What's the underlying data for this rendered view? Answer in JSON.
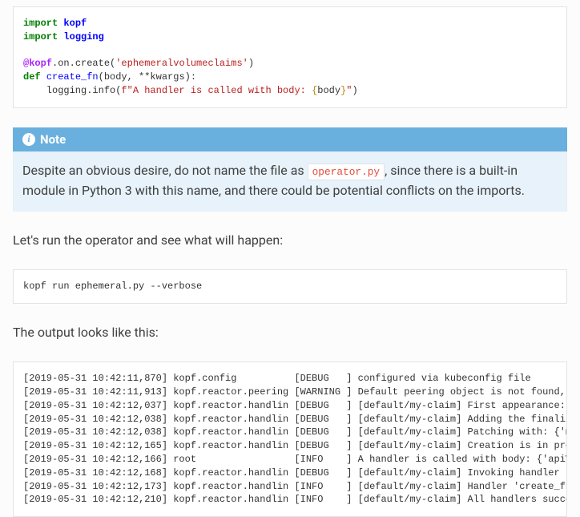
{
  "code": {
    "import_kw": "import",
    "kopf": "kopf",
    "logging": "logging",
    "at": "@kopf",
    "decorator_tail": ".on.create(",
    "resource": "'ephemeralvolumeclaims'",
    "decorator_close": ")",
    "def_kw": "def",
    "fn_name": "create_fn",
    "fn_sig": "(body, **kwargs):",
    "log_call": "    logging.info(",
    "fprefix": "f\"A handler is called with body: ",
    "interp_open": "{",
    "interp_var": "body",
    "interp_close": "}",
    "fclose": "\"",
    "call_close": ")"
  },
  "note": {
    "title": "Note",
    "body_before": "Despite an obvious desire, do not name the file as ",
    "code": "operator.py",
    "body_after": ", since there is a built-in module in Python 3 with this name, and there could be potential conflicts on the imports."
  },
  "para1": "Let's run the operator and see what will happen:",
  "shell": "kopf run ephemeral.py --verbose",
  "para2": "The output looks like this:",
  "log_lines": [
    "[2019-05-31 10:42:11,870] kopf.config          [DEBUG   ] configured via kubeconfig file",
    "[2019-05-31 10:42:11,913] kopf.reactor.peering [WARNING ] Default peering object is not found, falling b",
    "[2019-05-31 10:42:12,037] kopf.reactor.handlin [DEBUG   ] [default/my-claim] First appearance: {'apiVers",
    "[2019-05-31 10:42:12,038] kopf.reactor.handlin [DEBUG   ] [default/my-claim] Adding the finalizer, thus ",
    "[2019-05-31 10:42:12,038] kopf.reactor.handlin [DEBUG   ] [default/my-claim] Patching with: {'metadata' ",
    "[2019-05-31 10:42:12,165] kopf.reactor.handlin [DEBUG   ] [default/my-claim] Creation is in progress: {'",
    "[2019-05-31 10:42:12,166] root                 [INFO    ] A handler is called with body: {'apiVersion': ",
    "[2019-05-31 10:42:12,168] kopf.reactor.handlin [DEBUG   ] [default/my-claim] Invoking handler 'create_fn",
    "[2019-05-31 10:42:12,173] kopf.reactor.handlin [INFO    ] [default/my-claim] Handler 'create_fn' succeed",
    "[2019-05-31 10:42:12,210] kopf.reactor.handlin [INFO    ] [default/my-claim] All handlers succeeded for "
  ]
}
